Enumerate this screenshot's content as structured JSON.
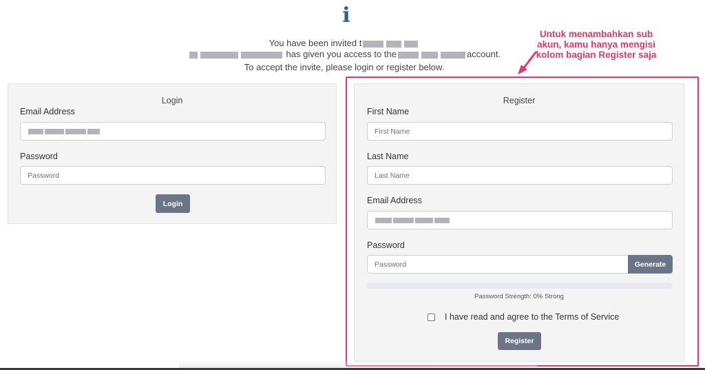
{
  "header": {
    "info_icon": "info-icon",
    "invite_line1": "You have been invited t",
    "invite_line2_mid": "has given you access to the",
    "invite_line2_end": "account.",
    "invite_line3": "To accept the invite, please login or register below."
  },
  "annotation": {
    "text": "Untuk menambahkan sub akun, kamu hanya mengisi kolom bagian Register saja",
    "color": "#e23a6d"
  },
  "login": {
    "title": "Login",
    "email_label": "Email Address",
    "email_value": "",
    "password_label": "Password",
    "password_placeholder": "Password",
    "button_label": "Login"
  },
  "register": {
    "title": "Register",
    "first_name_label": "First Name",
    "first_name_placeholder": "First Name",
    "last_name_label": "Last Name",
    "last_name_placeholder": "Last Name",
    "email_label": "Email Address",
    "email_value": "",
    "password_label": "Password",
    "password_placeholder": "Password",
    "generate_label": "Generate",
    "strength_text": "Password Strength: 0% Strong",
    "strength_percent": 0,
    "tos_label": "I have read and agree to the Terms of Service",
    "button_label": "Register"
  },
  "colors": {
    "accent": "#e23a6d",
    "button": "#6c7487",
    "icon": "#2f5f8f"
  }
}
